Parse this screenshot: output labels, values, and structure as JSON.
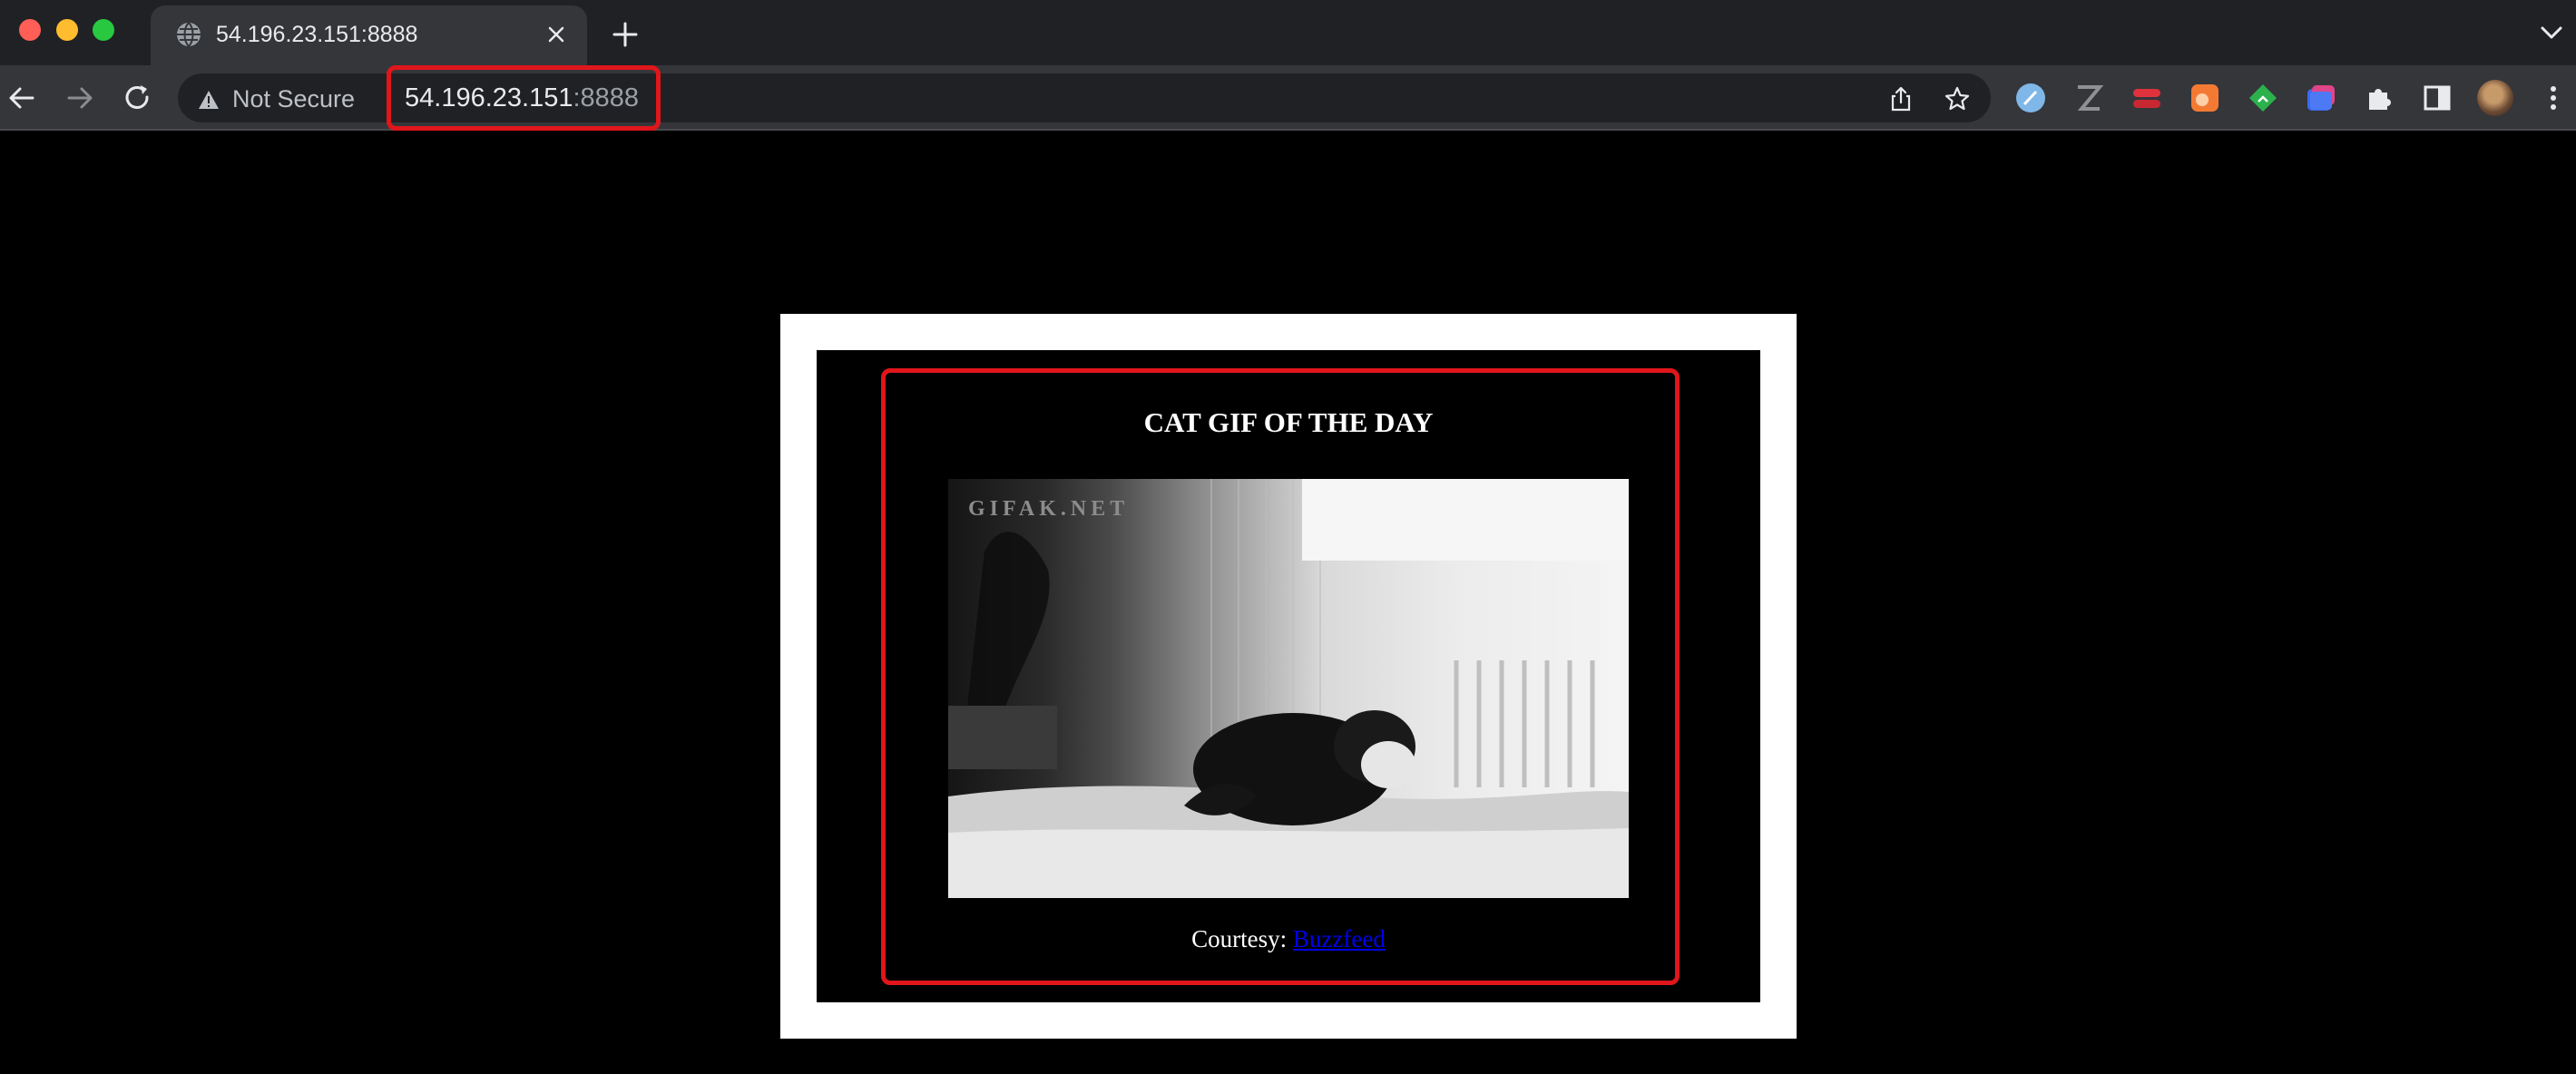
{
  "browser": {
    "tab": {
      "title": "54.196.23.151:8888"
    },
    "toolbar": {
      "security_label": "Not Secure",
      "url_host": "54.196.23.151",
      "url_port": ":8888"
    },
    "extensions": [
      "compass-extension-icon",
      "zotero-extension-icon",
      "lastpass-extension-icon",
      "orange-extension-icon",
      "feedly-extension-icon",
      "tab-manager-extension-icon",
      "puzzle-icon",
      "sidebar-icon"
    ],
    "colors": {
      "highlight": "#e0161b",
      "link": "#0000ee"
    }
  },
  "page": {
    "heading": "CAT GIF OF THE DAY",
    "gif_watermark": "GIFAK.NET",
    "courtesy_label": "Courtesy: ",
    "courtesy_link": "Buzzfeed"
  }
}
